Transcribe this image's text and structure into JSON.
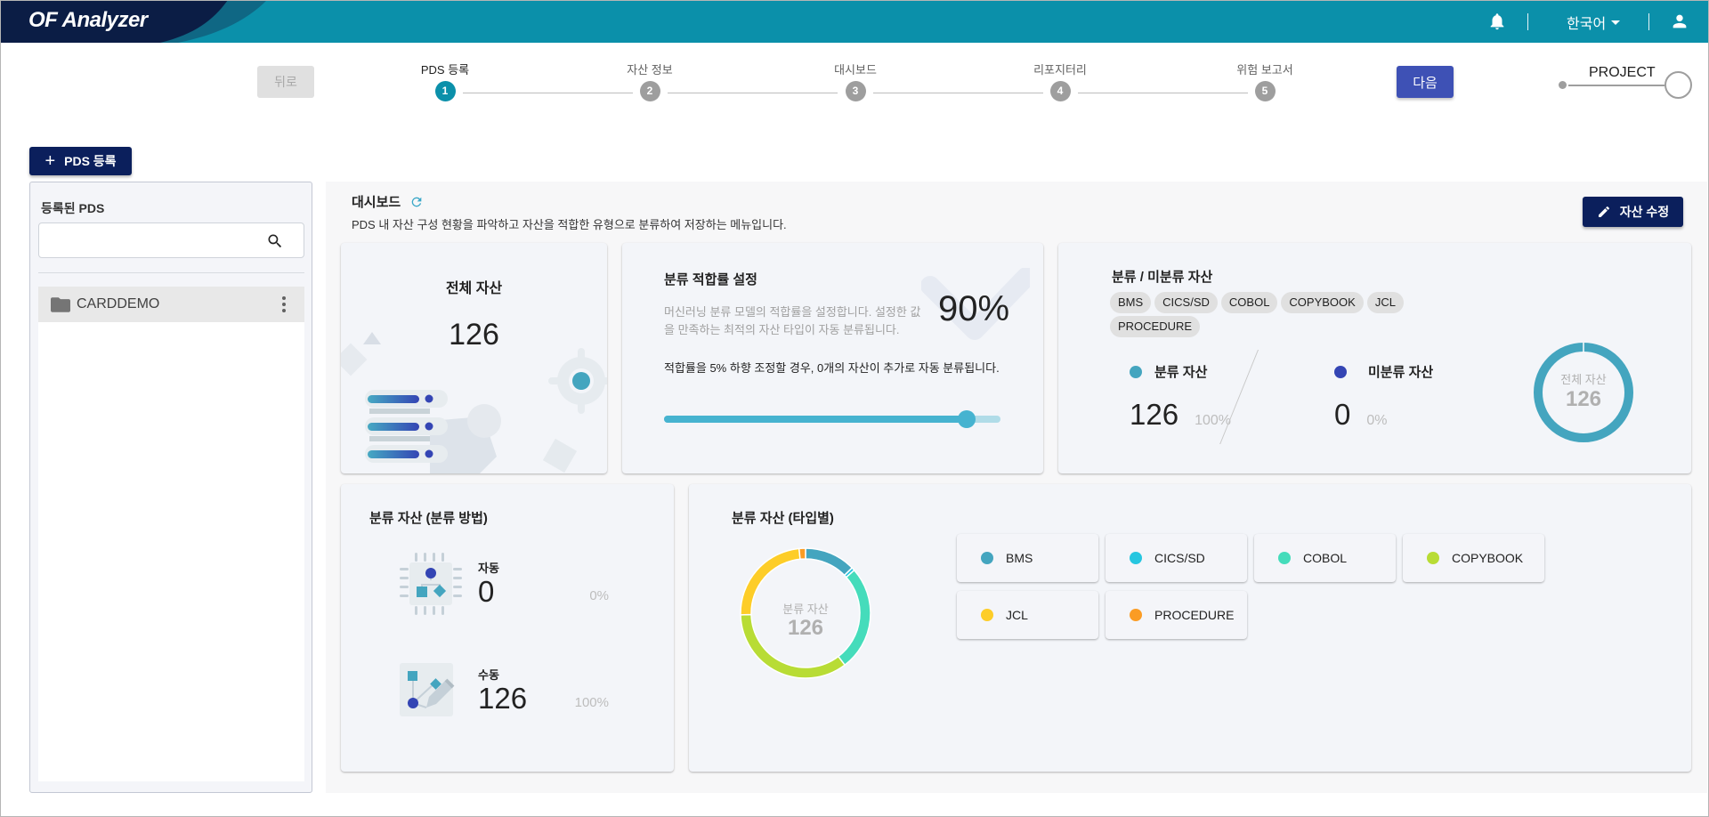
{
  "app": {
    "title": "OF Analyzer",
    "language": "한국어"
  },
  "header": {
    "icons": [
      "bell-icon",
      "user-icon"
    ],
    "colors": {
      "primary": "#0b90aa",
      "navy": "#0b1d45"
    }
  },
  "stepper": {
    "back_label": "뒤로",
    "next_label": "다음",
    "steps": [
      {
        "num": "1",
        "label": "PDS 등록",
        "active": true
      },
      {
        "num": "2",
        "label": "자산 정보",
        "active": false
      },
      {
        "num": "3",
        "label": "대시보드",
        "active": false
      },
      {
        "num": "4",
        "label": "리포지터리",
        "active": false
      },
      {
        "num": "5",
        "label": "위험 보고서",
        "active": false
      }
    ],
    "project_label": "PROJECT"
  },
  "sidebar": {
    "add_button_label": "PDS 등록",
    "title": "등록된 PDS",
    "search": {
      "value": "",
      "placeholder": ""
    },
    "items": [
      {
        "name": "CARDDEMO",
        "selected": true
      }
    ]
  },
  "dashboard": {
    "title": "대시보드",
    "description": "PDS 내 자산 구성 현황을 파악하고 자산을 적합한 유형으로 분류하여 저장하는 메뉴입니다.",
    "edit_button_label": "자산 수정",
    "total_assets": {
      "title": "전체 자산",
      "value": "126"
    },
    "fit_rate": {
      "title": "분류 적합률 설정",
      "description": "머신러닝 분류 모델의 적합률을 설정합니다. 설정한 값을 만족하는 최적의 자산 타입이 자동 분류됩니다.",
      "note": "적합률을 5% 하향 조정할 경우, 0개의 자산이 추가로 자동 분류됩니다.",
      "value_label": "90%",
      "value_percent": 90,
      "slider_max_percent": 100
    },
    "classified_unclassified": {
      "title": "분류 / 미분류 자산",
      "chips": [
        "BMS",
        "CICS/SD",
        "COBOL",
        "COPYBOOK",
        "JCL",
        "PROCEDURE"
      ],
      "classified": {
        "label": "분류 자산",
        "value": "126",
        "percent": "100%",
        "color": "#44a5bf"
      },
      "unclassified": {
        "label": "미분류 자산",
        "value": "0",
        "percent": "0%",
        "color": "#3445b4"
      },
      "ring": {
        "label": "전체 자산",
        "value": "126"
      }
    },
    "by_method": {
      "title": "분류 자산 (분류 방법)",
      "auto": {
        "label": "자동",
        "value": "0",
        "percent": "0%"
      },
      "manual": {
        "label": "수동",
        "value": "126",
        "percent": "100%"
      }
    },
    "by_type": {
      "title": "분류 자산 (타입별)",
      "center_label": "분류 자산",
      "center_value": "126"
    }
  },
  "chart_data": {
    "type": "pie",
    "title": "분류 자산 (타입별)",
    "subtype": "donut",
    "center_text": [
      "분류 자산",
      "126"
    ],
    "categories": [
      "BMS",
      "CICS/SD",
      "COBOL",
      "COPYBOOK",
      "JCL",
      "PROCEDURE"
    ],
    "values": [
      16,
      1,
      33,
      44,
      30,
      2
    ],
    "colors": [
      "#44a5bf",
      "#26c6e0",
      "#45dcbb",
      "#b8dc35",
      "#fdcd28",
      "#fb9c24"
    ],
    "legend": "right",
    "total": 126
  }
}
